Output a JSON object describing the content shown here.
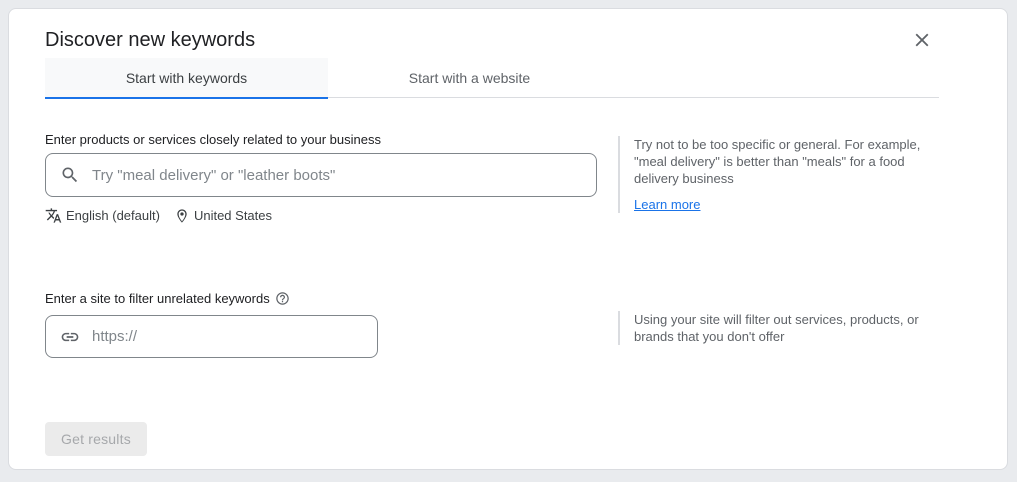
{
  "dialog": {
    "title": "Discover new keywords"
  },
  "tabs": [
    {
      "label": "Start with keywords",
      "active": true
    },
    {
      "label": "Start with a website",
      "active": false
    }
  ],
  "keywords_section": {
    "label": "Enter products or services closely related to your business",
    "input_value": "",
    "input_placeholder": "Try \"meal delivery\" or \"leather boots\"",
    "language": "English (default)",
    "location": "United States",
    "help_text": "Try not to be too specific or general. For example, \"meal delivery\" is better than \"meals\" for a food delivery business",
    "learn_more_label": "Learn more"
  },
  "site_section": {
    "label": "Enter a site to filter unrelated keywords",
    "input_value": "",
    "input_placeholder": "https://",
    "help_text": "Using your site will filter out services, products, or brands that you don't offer"
  },
  "footer": {
    "get_results_label": "Get results"
  },
  "icons": {
    "close": "close-icon",
    "search": "search-icon",
    "translate": "translate-icon",
    "location": "location-pin-icon",
    "help": "help-circle-icon",
    "link": "link-icon"
  },
  "colors": {
    "accent_blue": "#1a73e8",
    "link_blue": "#1a73e8",
    "page_background": "#e9ebee",
    "card_border": "#dadce0",
    "active_tab_background": "#f8f9fa",
    "disabled_button_background": "#ebebeb",
    "text_primary": "#202124",
    "text_secondary": "#5f6368"
  }
}
